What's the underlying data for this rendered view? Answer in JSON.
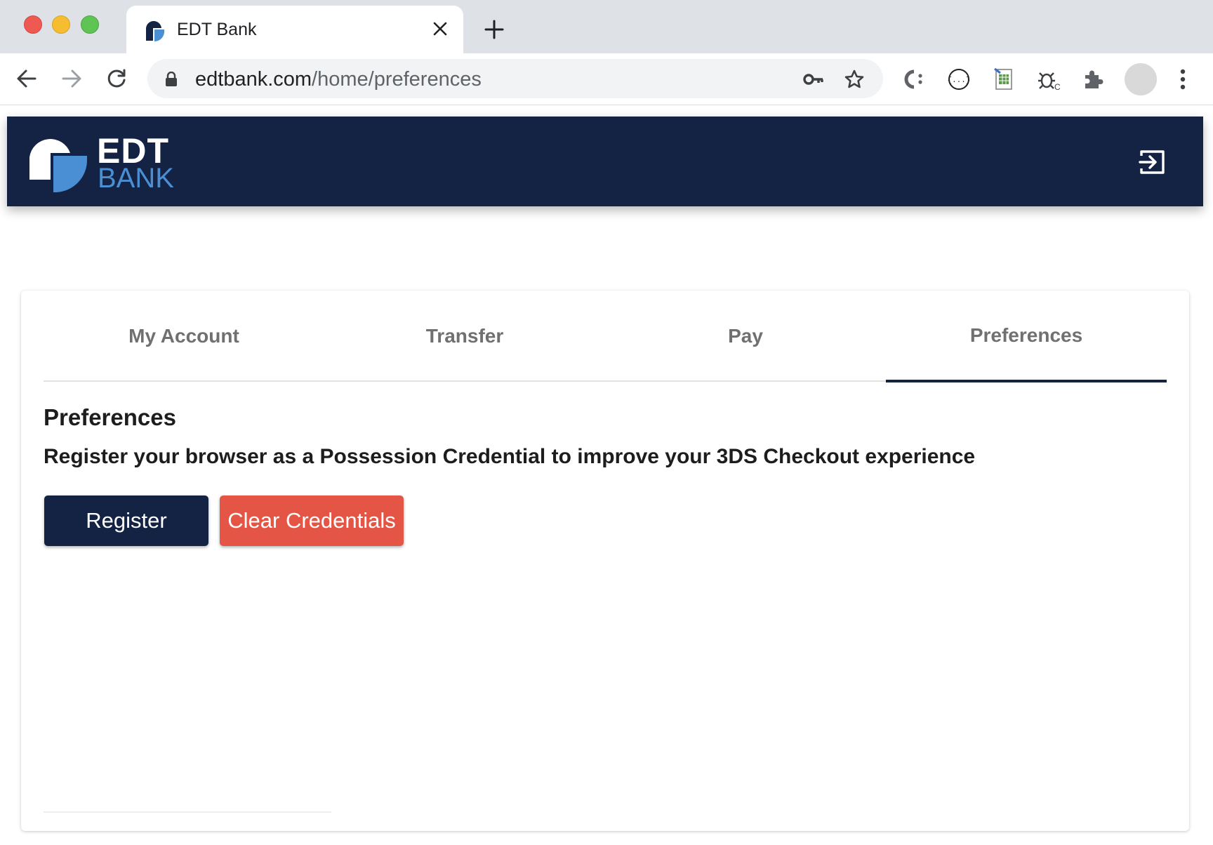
{
  "browser": {
    "tab": {
      "title": "EDT Bank",
      "favicon": "edt-bank-logo"
    },
    "address_bar": {
      "host": "edtbank.com",
      "path": "/home/preferences"
    },
    "icons": [
      "back-arrow-icon",
      "forward-arrow-icon",
      "reload-icon",
      "lock-icon",
      "key-icon",
      "star-icon",
      "extension-icons",
      "puzzle-icon",
      "profile-avatar",
      "menu-dots-icon"
    ]
  },
  "header": {
    "logo": {
      "line1": "EDT",
      "line2": "BANK"
    },
    "logout_icon": "logout-icon"
  },
  "nav_tabs": [
    {
      "label": "My Account",
      "active": false
    },
    {
      "label": "Transfer",
      "active": false
    },
    {
      "label": "Pay",
      "active": false
    },
    {
      "label": "Preferences",
      "active": true
    }
  ],
  "preferences": {
    "title": "Preferences",
    "description": "Register your browser as a Possession Credential to improve your 3DS Checkout experience",
    "register_label": "Register",
    "clear_label": "Clear Credentials"
  },
  "colors": {
    "brand_navy": "#142343",
    "brand_blue": "#4a8fd4",
    "danger": "#e55545",
    "tab_text": "#707070"
  }
}
